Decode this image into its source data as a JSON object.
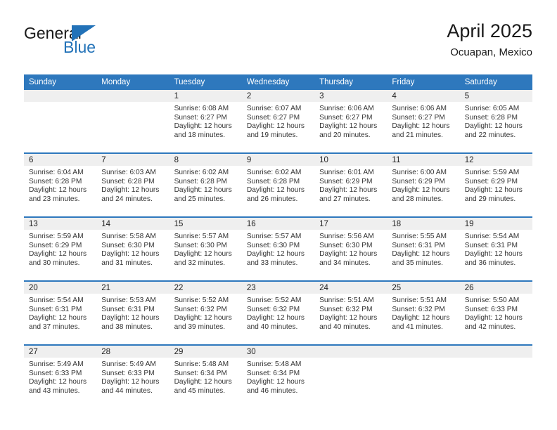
{
  "brand": {
    "name_part1": "General",
    "name_part2": "Blue",
    "flag_color": "#2272b8"
  },
  "header": {
    "title": "April 2025",
    "location": "Ocuapan, Mexico"
  },
  "theme": {
    "header_blue": "#2e78bd",
    "daynum_gray": "#efefef",
    "text": "#222222"
  },
  "weekday_headers": [
    "Sunday",
    "Monday",
    "Tuesday",
    "Wednesday",
    "Thursday",
    "Friday",
    "Saturday"
  ],
  "weeks": [
    [
      {
        "day": "",
        "sunrise": "",
        "sunset": "",
        "daylight1": "",
        "daylight2": "",
        "empty": true
      },
      {
        "day": "",
        "sunrise": "",
        "sunset": "",
        "daylight1": "",
        "daylight2": "",
        "empty": true
      },
      {
        "day": "1",
        "sunrise": "Sunrise: 6:08 AM",
        "sunset": "Sunset: 6:27 PM",
        "daylight1": "Daylight: 12 hours",
        "daylight2": "and 18 minutes."
      },
      {
        "day": "2",
        "sunrise": "Sunrise: 6:07 AM",
        "sunset": "Sunset: 6:27 PM",
        "daylight1": "Daylight: 12 hours",
        "daylight2": "and 19 minutes."
      },
      {
        "day": "3",
        "sunrise": "Sunrise: 6:06 AM",
        "sunset": "Sunset: 6:27 PM",
        "daylight1": "Daylight: 12 hours",
        "daylight2": "and 20 minutes."
      },
      {
        "day": "4",
        "sunrise": "Sunrise: 6:06 AM",
        "sunset": "Sunset: 6:27 PM",
        "daylight1": "Daylight: 12 hours",
        "daylight2": "and 21 minutes."
      },
      {
        "day": "5",
        "sunrise": "Sunrise: 6:05 AM",
        "sunset": "Sunset: 6:28 PM",
        "daylight1": "Daylight: 12 hours",
        "daylight2": "and 22 minutes."
      }
    ],
    [
      {
        "day": "6",
        "sunrise": "Sunrise: 6:04 AM",
        "sunset": "Sunset: 6:28 PM",
        "daylight1": "Daylight: 12 hours",
        "daylight2": "and 23 minutes."
      },
      {
        "day": "7",
        "sunrise": "Sunrise: 6:03 AM",
        "sunset": "Sunset: 6:28 PM",
        "daylight1": "Daylight: 12 hours",
        "daylight2": "and 24 minutes."
      },
      {
        "day": "8",
        "sunrise": "Sunrise: 6:02 AM",
        "sunset": "Sunset: 6:28 PM",
        "daylight1": "Daylight: 12 hours",
        "daylight2": "and 25 minutes."
      },
      {
        "day": "9",
        "sunrise": "Sunrise: 6:02 AM",
        "sunset": "Sunset: 6:28 PM",
        "daylight1": "Daylight: 12 hours",
        "daylight2": "and 26 minutes."
      },
      {
        "day": "10",
        "sunrise": "Sunrise: 6:01 AM",
        "sunset": "Sunset: 6:29 PM",
        "daylight1": "Daylight: 12 hours",
        "daylight2": "and 27 minutes."
      },
      {
        "day": "11",
        "sunrise": "Sunrise: 6:00 AM",
        "sunset": "Sunset: 6:29 PM",
        "daylight1": "Daylight: 12 hours",
        "daylight2": "and 28 minutes."
      },
      {
        "day": "12",
        "sunrise": "Sunrise: 5:59 AM",
        "sunset": "Sunset: 6:29 PM",
        "daylight1": "Daylight: 12 hours",
        "daylight2": "and 29 minutes."
      }
    ],
    [
      {
        "day": "13",
        "sunrise": "Sunrise: 5:59 AM",
        "sunset": "Sunset: 6:29 PM",
        "daylight1": "Daylight: 12 hours",
        "daylight2": "and 30 minutes."
      },
      {
        "day": "14",
        "sunrise": "Sunrise: 5:58 AM",
        "sunset": "Sunset: 6:30 PM",
        "daylight1": "Daylight: 12 hours",
        "daylight2": "and 31 minutes."
      },
      {
        "day": "15",
        "sunrise": "Sunrise: 5:57 AM",
        "sunset": "Sunset: 6:30 PM",
        "daylight1": "Daylight: 12 hours",
        "daylight2": "and 32 minutes."
      },
      {
        "day": "16",
        "sunrise": "Sunrise: 5:57 AM",
        "sunset": "Sunset: 6:30 PM",
        "daylight1": "Daylight: 12 hours",
        "daylight2": "and 33 minutes."
      },
      {
        "day": "17",
        "sunrise": "Sunrise: 5:56 AM",
        "sunset": "Sunset: 6:30 PM",
        "daylight1": "Daylight: 12 hours",
        "daylight2": "and 34 minutes."
      },
      {
        "day": "18",
        "sunrise": "Sunrise: 5:55 AM",
        "sunset": "Sunset: 6:31 PM",
        "daylight1": "Daylight: 12 hours",
        "daylight2": "and 35 minutes."
      },
      {
        "day": "19",
        "sunrise": "Sunrise: 5:54 AM",
        "sunset": "Sunset: 6:31 PM",
        "daylight1": "Daylight: 12 hours",
        "daylight2": "and 36 minutes."
      }
    ],
    [
      {
        "day": "20",
        "sunrise": "Sunrise: 5:54 AM",
        "sunset": "Sunset: 6:31 PM",
        "daylight1": "Daylight: 12 hours",
        "daylight2": "and 37 minutes."
      },
      {
        "day": "21",
        "sunrise": "Sunrise: 5:53 AM",
        "sunset": "Sunset: 6:31 PM",
        "daylight1": "Daylight: 12 hours",
        "daylight2": "and 38 minutes."
      },
      {
        "day": "22",
        "sunrise": "Sunrise: 5:52 AM",
        "sunset": "Sunset: 6:32 PM",
        "daylight1": "Daylight: 12 hours",
        "daylight2": "and 39 minutes."
      },
      {
        "day": "23",
        "sunrise": "Sunrise: 5:52 AM",
        "sunset": "Sunset: 6:32 PM",
        "daylight1": "Daylight: 12 hours",
        "daylight2": "and 40 minutes."
      },
      {
        "day": "24",
        "sunrise": "Sunrise: 5:51 AM",
        "sunset": "Sunset: 6:32 PM",
        "daylight1": "Daylight: 12 hours",
        "daylight2": "and 40 minutes."
      },
      {
        "day": "25",
        "sunrise": "Sunrise: 5:51 AM",
        "sunset": "Sunset: 6:32 PM",
        "daylight1": "Daylight: 12 hours",
        "daylight2": "and 41 minutes."
      },
      {
        "day": "26",
        "sunrise": "Sunrise: 5:50 AM",
        "sunset": "Sunset: 6:33 PM",
        "daylight1": "Daylight: 12 hours",
        "daylight2": "and 42 minutes."
      }
    ],
    [
      {
        "day": "27",
        "sunrise": "Sunrise: 5:49 AM",
        "sunset": "Sunset: 6:33 PM",
        "daylight1": "Daylight: 12 hours",
        "daylight2": "and 43 minutes."
      },
      {
        "day": "28",
        "sunrise": "Sunrise: 5:49 AM",
        "sunset": "Sunset: 6:33 PM",
        "daylight1": "Daylight: 12 hours",
        "daylight2": "and 44 minutes."
      },
      {
        "day": "29",
        "sunrise": "Sunrise: 5:48 AM",
        "sunset": "Sunset: 6:34 PM",
        "daylight1": "Daylight: 12 hours",
        "daylight2": "and 45 minutes."
      },
      {
        "day": "30",
        "sunrise": "Sunrise: 5:48 AM",
        "sunset": "Sunset: 6:34 PM",
        "daylight1": "Daylight: 12 hours",
        "daylight2": "and 46 minutes."
      },
      {
        "day": "",
        "sunrise": "",
        "sunset": "",
        "daylight1": "",
        "daylight2": "",
        "empty": true
      },
      {
        "day": "",
        "sunrise": "",
        "sunset": "",
        "daylight1": "",
        "daylight2": "",
        "empty": true
      },
      {
        "day": "",
        "sunrise": "",
        "sunset": "",
        "daylight1": "",
        "daylight2": "",
        "empty": true
      }
    ]
  ]
}
